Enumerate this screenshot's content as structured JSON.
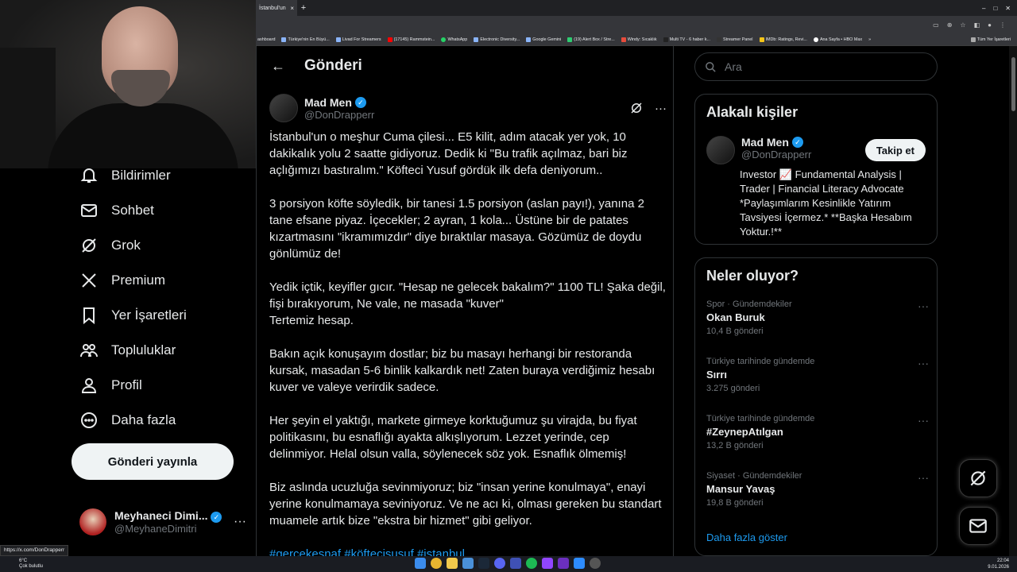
{
  "browser": {
    "tab_title": "İstanbul'un",
    "tab_close": "×",
    "new_tab": "+",
    "window_controls": [
      "–",
      "□",
      "✕"
    ],
    "bookmarks": [
      "ashboard",
      "Türkiye'nin En Büyü...",
      "Livad For Streamers",
      "(17145) Rammstein...",
      "WhatsApp",
      "Electronic Diversity...",
      "Google Gemini",
      "(19) Alert Box / Stre...",
      "Windy: Sıcaklık",
      "Multi TV - 6 haber k...",
      "Streamer Panel",
      "IMDb: Ratings, Revi...",
      "Ana Sayfa • HBO Max"
    ],
    "bookmarks_more": "»",
    "all_bookmarks": "Tüm Yer İşaretleri",
    "status_url": "https://x.com/DonDrapperr"
  },
  "sidebar": {
    "items": [
      {
        "label": "Bildirimler",
        "icon": "bell-icon"
      },
      {
        "label": "Sohbet",
        "icon": "mail-icon"
      },
      {
        "label": "Grok",
        "icon": "grok-icon"
      },
      {
        "label": "Premium",
        "icon": "x-logo-icon"
      },
      {
        "label": "Yer İşaretleri",
        "icon": "bookmark-icon"
      },
      {
        "label": "Topluluklar",
        "icon": "people-icon"
      },
      {
        "label": "Profil",
        "icon": "person-icon"
      },
      {
        "label": "Daha fazla",
        "icon": "more-circle-icon"
      }
    ],
    "post_button": "Gönderi yayınla",
    "account": {
      "name": "Meyhaneci Dimi...",
      "handle": "@MeyhaneDimitri",
      "more": "···"
    }
  },
  "main": {
    "back": "←",
    "title": "Gönderi",
    "post": {
      "author": "Mad Men",
      "handle": "@DonDrapperr",
      "more": "···",
      "paragraphs": [
        "İstanbul'un o meşhur Cuma çilesi... E5 kilit, adım atacak yer yok, 10 dakikalık yolu 2 saatte gidiyoruz. Dedik ki \"Bu trafik açılmaz, bari biz açlığımızı bastıralım.\" Köfteci Yusuf gördük ilk defa deniyorum..",
        "3 porsiyon köfte söyledik, bir tanesi 1.5 porsiyon (aslan payı!), yanına 2 tane efsane piyaz. İçecekler; 2 ayran, 1 kola... Üstüne bir de patates kızartmasını \"ikramımızdır\" diye bıraktılar masaya. Gözümüz de doydu gönlümüz de!",
        "Yedik içtik, keyifler gıcır. \"Hesap ne gelecek bakalım?\" 1100 TL! Şaka değil, fişi bırakıyorum, Ne vale, ne masada \"kuver\"\nTertemiz hesap.",
        "Bakın açık konuşayım dostlar; biz bu masayı herhangi bir restoranda kursak, masadan 5-6 binlik kalkardık net! Zaten buraya verdiğimiz hesabı kuver ve valeye verirdik sadece.",
        "Her şeyin el yaktığı, markete girmeye korktuğumuz şu virajda, bu fiyat politikasını, bu esnaflığı ayakta alkışlıyorum. Lezzet yerinde, cep delinmiyor. Helal olsun valla, söylenecek söz yok. Esnaflık ölmemiş!",
        "Biz aslında ucuzluğa sevinmiyoruz; biz \"insan yerine konulmaya\", enayi yerine konulmamaya seviniyoruz. Ve ne acı ki, olması gereken bu standart muamele artık bize \"ekstra bir hizmet\" gibi geliyor."
      ],
      "hashtags": "#gerçekesnaf #köftecisusuf #istanbul"
    }
  },
  "right": {
    "search_placeholder": "Ara",
    "related": {
      "title": "Alakalı kişiler",
      "name": "Mad Men",
      "handle": "@DonDrapperr",
      "follow": "Takip et",
      "bio": "Investor 📈 Fundamental Analysis | Trader | Financial Literacy Advocate *Paylaşımlarım Kesinlikle Yatırım Tavsiyesi İçermez.* **Başka Hesabım Yoktur.!**"
    },
    "trends": {
      "title": "Neler oluyor?",
      "items": [
        {
          "meta": "Spor · Gündemdekiler",
          "name": "Okan Buruk",
          "count": "10,4 B gönderi"
        },
        {
          "meta": "Türkiye tarihinde gündemde",
          "name": "Sırrı",
          "count": "3.275 gönderi"
        },
        {
          "meta": "Türkiye tarihinde gündemde",
          "name": "#ZeynepAtılgan",
          "count": "13,2 B gönderi"
        },
        {
          "meta": "Siyaset · Gündemdekiler",
          "name": "Mansur Yavaş",
          "count": "19,8 B gönderi"
        }
      ],
      "more": "···",
      "show_more": "Daha fazla göster"
    }
  },
  "taskbar": {
    "temp": "6°C",
    "weather": "Çok bulutlu",
    "time": "22:04",
    "date": "9.01.2026"
  },
  "colors": {
    "accent": "#1d9bf0",
    "background": "#000000",
    "border": "#2f3336"
  }
}
